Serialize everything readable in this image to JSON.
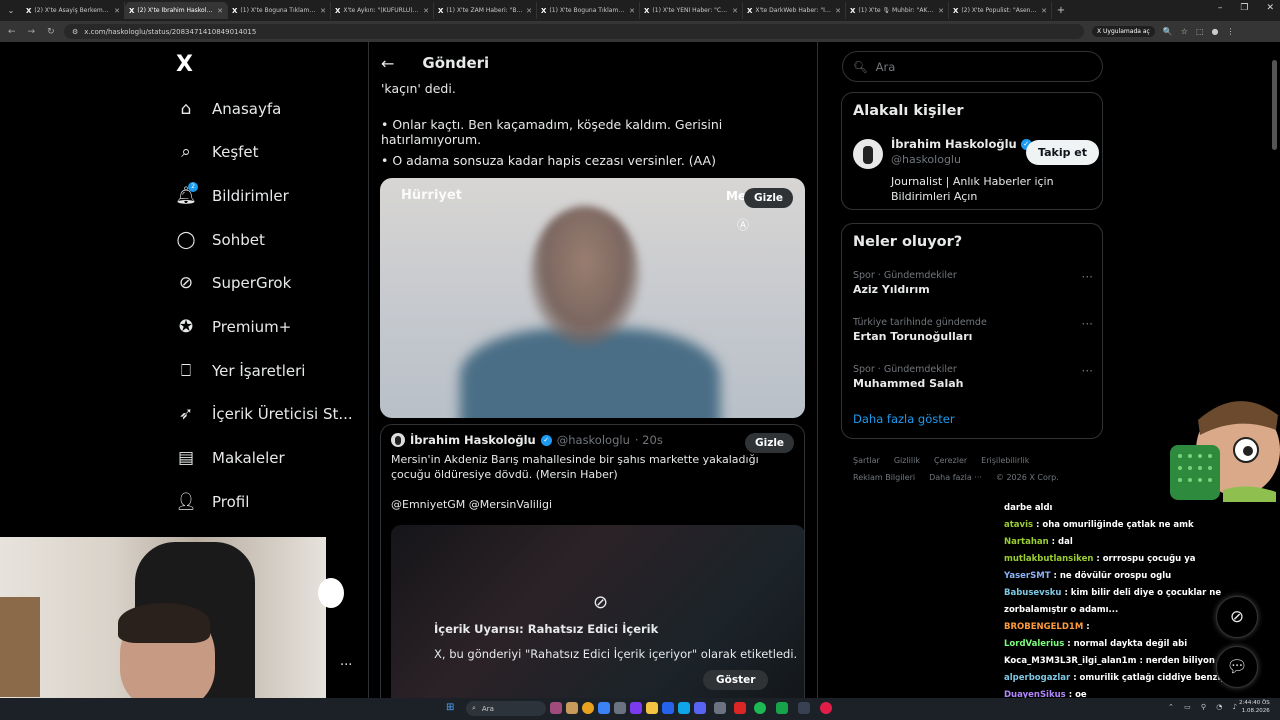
{
  "browser": {
    "tabs": [
      {
        "label": "(2) X'te Asayiş Berkemall: \"Me…",
        "active": false
      },
      {
        "label": "(2) X'te İbrahim Haskoloğ…",
        "active": true
      },
      {
        "label": "(1) X'te Boguna Tıklama: \"Bir c…",
        "active": false
      },
      {
        "label": "X'te Aykırı: \"(KÜFÜRLÜ) Aracı…",
        "active": false
      },
      {
        "label": "(1) X'te ZAM Haberi: \"Boşanar…",
        "active": false
      },
      {
        "label": "(1) X'te Boguna Tıklama: \"7. U…",
        "active": false
      },
      {
        "label": "(1) X'te YENİ Haber: \"CHP İzm…",
        "active": false
      },
      {
        "label": "X'te DarkWeb Haber: \"İkinci el…",
        "active": false
      },
      {
        "label": "(1) X'te 🎙 Muhbir: \"AKP'li Al…",
        "active": false
      },
      {
        "label": "(2) X'te Populist: \"Asena Kesk…",
        "active": false
      }
    ],
    "url": "x.com/haskologlu/status/2083471410849014015",
    "apps_label": "Uygulamada aç"
  },
  "sidebar": {
    "logo": "X",
    "items": [
      {
        "label": "Anasayfa",
        "icon": "home-icon"
      },
      {
        "label": "Keşfet",
        "icon": "search-icon"
      },
      {
        "label": "Bildirimler",
        "icon": "bell-icon",
        "badge": "2"
      },
      {
        "label": "Sohbet",
        "icon": "chat-icon"
      },
      {
        "label": "SuperGrok",
        "icon": "grok-icon"
      },
      {
        "label": "Premium+",
        "icon": "premium-icon"
      },
      {
        "label": "Yer İşaretleri",
        "icon": "bookmark-icon"
      },
      {
        "label": "İçerik Üreticisi St...",
        "icon": "rocket-icon"
      },
      {
        "label": "Makaleler",
        "icon": "article-icon"
      },
      {
        "label": "Profil",
        "icon": "profile-icon"
      }
    ],
    "more": "..."
  },
  "post": {
    "header_title": "Gönderi",
    "lines": [
      "'kaçın' dedi.",
      "• Onlar kaçtı. Ben kaçamadım, köşede kaldım. Gerisini hatırlamıyorum.",
      "• O adama sonsuza kadar hapis cezası versinler. (AA)"
    ],
    "media": {
      "watermark": "Hürriyet",
      "corner": "Me",
      "hide_label": "Gizle"
    },
    "quote": {
      "name": "İbrahim Haskoloğlu",
      "handle": "@haskologlu",
      "time": "· 20s",
      "hide_label": "Gizle",
      "text": "Mersin'in Akdeniz Barış mahallesinde bir şahıs markette yakaladığı çocuğu öldüresiye dövdü. (Mersin Haber)",
      "mentions": "@EmniyetGM @MersinValiligi",
      "warning_title": "İçerik Uyarısı: Rahatsız Edici İçerik",
      "warning_desc": "X, bu gönderiyi \"Rahatsız Edici İçerik içeriyor\" olarak etiketledi.",
      "show_label": "Göster"
    }
  },
  "right": {
    "search_placeholder": "Ara",
    "related": {
      "title": "Alakalı kişiler",
      "name": "İbrahim Haskoloğlu",
      "handle": "@haskologlu",
      "bio": "Journalist | Anlık Haberler için Bildirimleri Açın",
      "follow": "Takip et"
    },
    "trends": {
      "title": "Neler oluyor?",
      "items": [
        {
          "category": "Spor · Gündemdekiler",
          "name": "Aziz Yıldırım"
        },
        {
          "category": "Türkiye tarihinde gündemde",
          "name": "Ertan Torunoğulları"
        },
        {
          "category": "Spor · Gündemdekiler",
          "name": "Muhammed Salah"
        }
      ],
      "show_more": "Daha fazla göster"
    },
    "footer": [
      "Şartlar",
      "Gizlilik",
      "Çerezler",
      "Erişilebilirlik",
      "Reklam Bilgileri",
      "Daha fazla ···",
      "© 2026 X Corp."
    ]
  },
  "chat": {
    "lines": [
      {
        "user": "",
        "msg": "darbe aldı",
        "color": "#ffffff"
      },
      {
        "user": "atavis",
        "msg": ": oha omuriliğinde çatlak ne amk",
        "color": "#9acd32"
      },
      {
        "user": "Nartahan",
        "msg": ": dal",
        "color": "#9acd32"
      },
      {
        "user": "mutlakbutlansiken",
        "msg": ": orrrospu çocuğu ya",
        "color": "#9acd32"
      },
      {
        "user": "YaserSMT",
        "msg": ": ne dövülür orospu oglu",
        "color": "#8ab4f8"
      },
      {
        "user": "Babusevsku",
        "msg": ": kim bilir deli diye o çocuklar ne zorbalamıştır o adamı...",
        "color": "#7ec8e3"
      },
      {
        "user": "BROBENGELD1M",
        "msg": ":",
        "color": "#ff9a3c"
      },
      {
        "user": "LordValerius",
        "msg": ": normal daykta değil abi",
        "color": "#7cfc7c"
      },
      {
        "user": "Koca_M3M3L3R_ilgi_alan1m",
        "msg": ": nerden biliyon",
        "color": "#ffffff"
      },
      {
        "user": "alperbogazlar",
        "msg": ": omurilik çatlağı ciddiye benziyor",
        "color": "#7ec8e3"
      },
      {
        "user": "DuayenSikus",
        "msg": ": oe",
        "color": "#b388ff"
      }
    ]
  },
  "taskbar": {
    "search": "Ara",
    "time": "2:44:40 ÖS",
    "date": "1.08.2026"
  }
}
